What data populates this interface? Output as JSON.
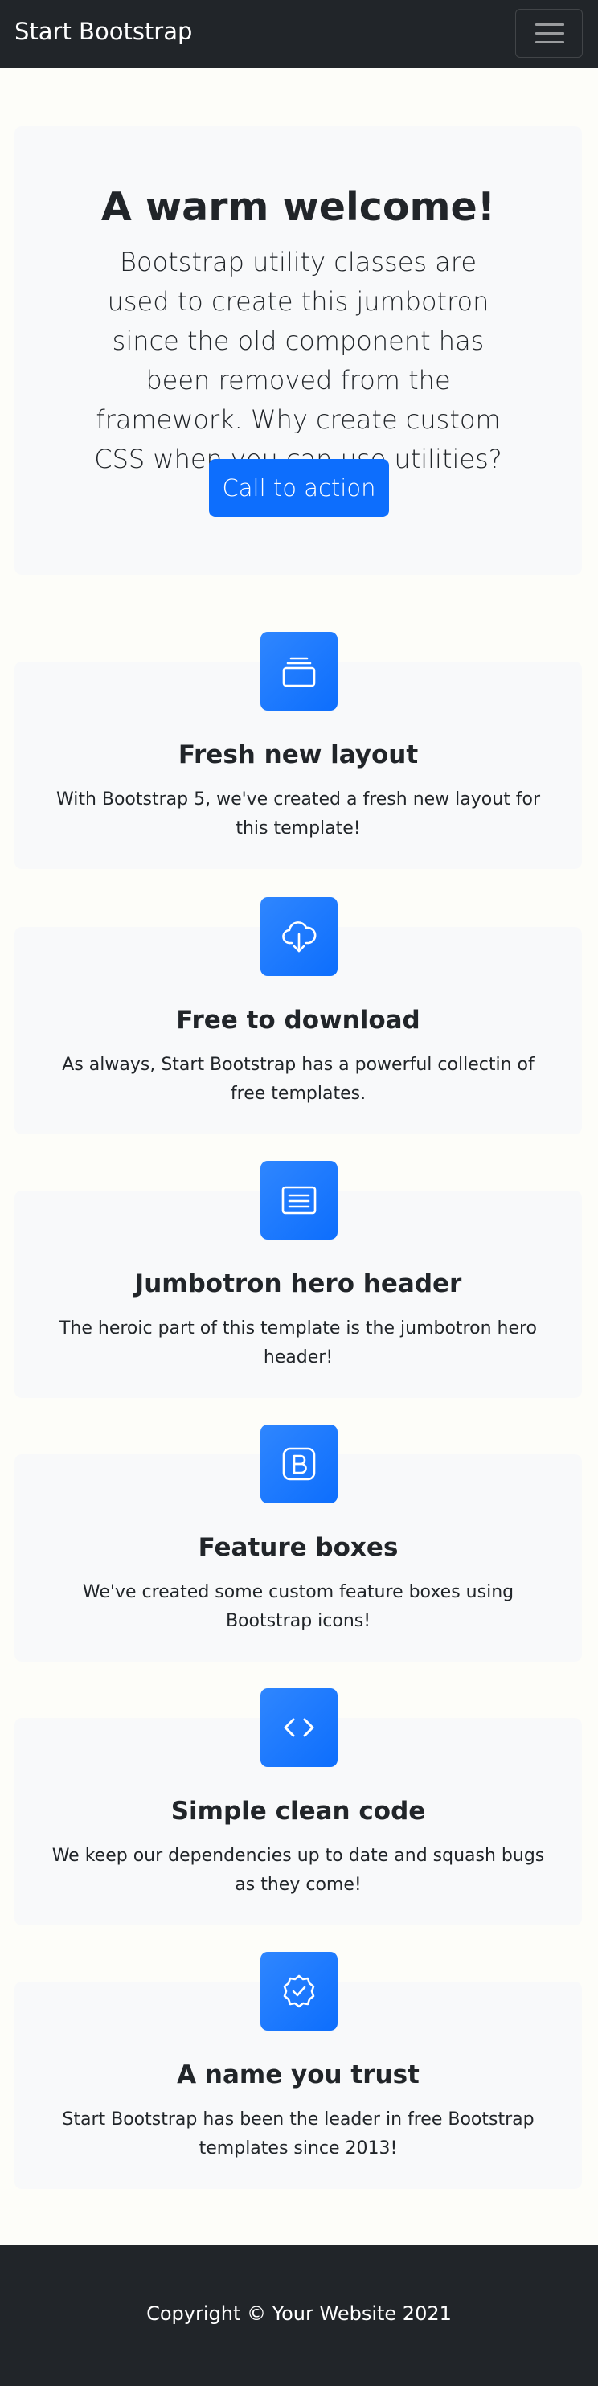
{
  "navbar": {
    "brand": "Start Bootstrap",
    "toggler_icon": "hamburger-icon"
  },
  "hero": {
    "title": "A warm welcome!",
    "lead": "Bootstrap utility classes are used to create this jumbotron since the old component has been removed from the framework. Why create custom CSS when you can use utilities?",
    "cta_label": "Call to action"
  },
  "features": [
    {
      "icon": "collection-icon",
      "title": "Fresh new layout",
      "text": "With Bootstrap 5, we've created a fresh new layout for this template!"
    },
    {
      "icon": "cloud-download-icon",
      "title": "Free to download",
      "text": "As always, Start Bootstrap has a powerful collectin of free templates."
    },
    {
      "icon": "card-heading-icon",
      "title": "Jumbotron hero header",
      "text": "The heroic part of this template is the jumbotron hero header!"
    },
    {
      "icon": "bootstrap-icon",
      "title": "Feature boxes",
      "text": "We've created some custom feature boxes using Bootstrap icons!"
    },
    {
      "icon": "code-icon",
      "title": "Simple clean code",
      "text": "We keep our dependencies up to date and squash bugs as they come!"
    },
    {
      "icon": "patch-check-icon",
      "title": "A name you trust",
      "text": "Start Bootstrap has been the leader in free Bootstrap templates since 2013!"
    }
  ],
  "footer": {
    "copyright": "Copyright © Your Website 2021"
  },
  "colors": {
    "navbar_bg": "#212529",
    "primary": "#0d6efd",
    "card_bg": "#f8f9fa",
    "page_bg": "#fdfdf9"
  }
}
